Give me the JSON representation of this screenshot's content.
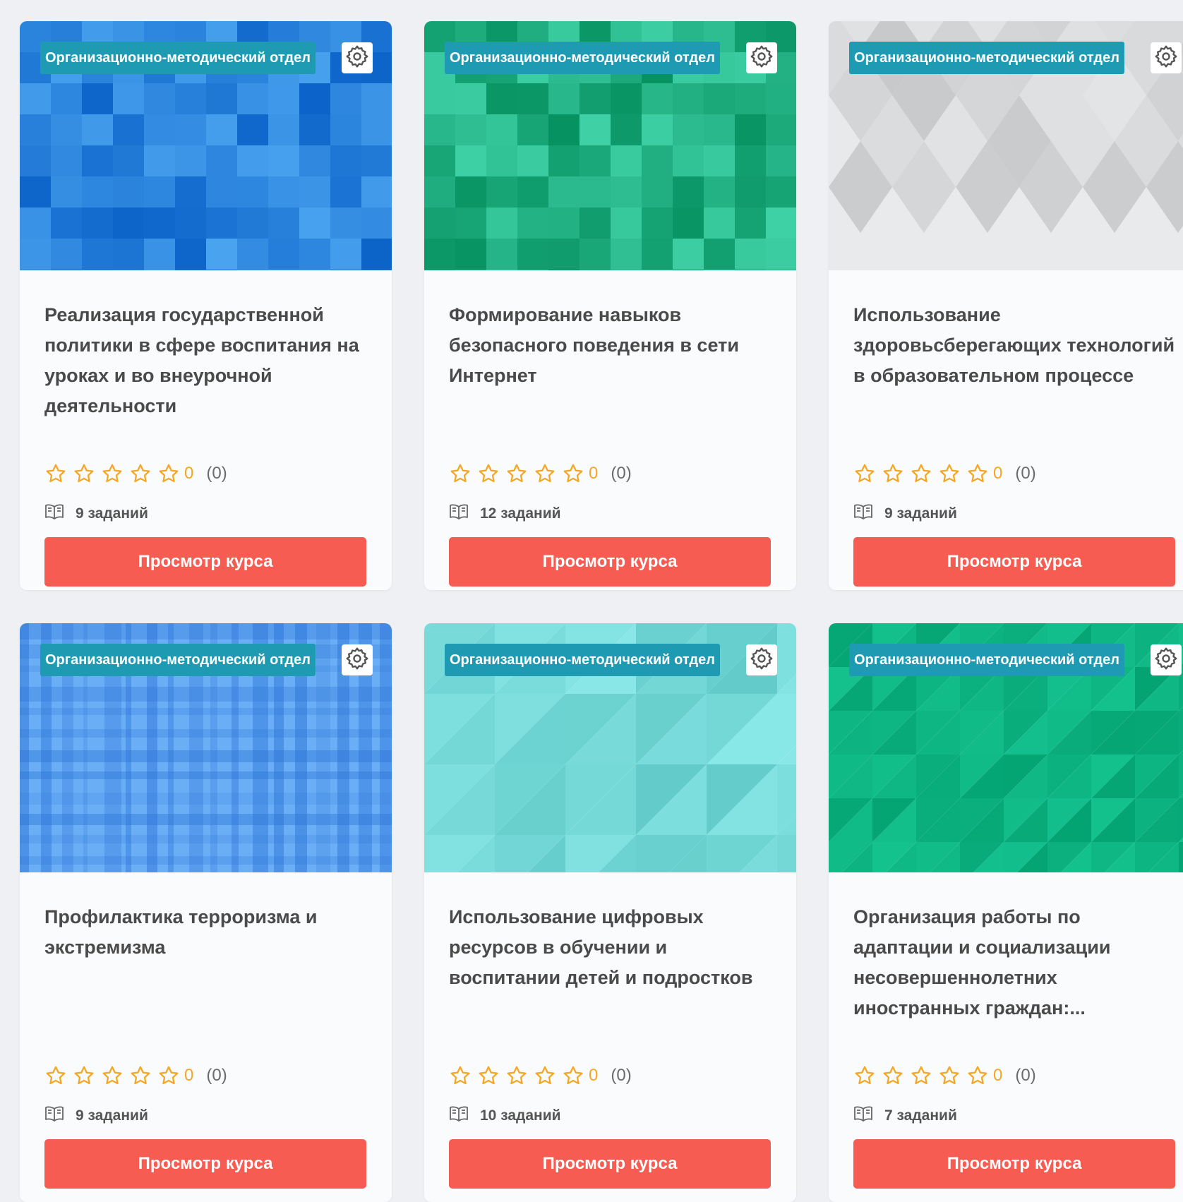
{
  "courses": [
    {
      "department": "Организационно-методический отдел",
      "title": "Реализация государственной политики в сфере воспитания на уроках и во внеурочной деятельности",
      "rating": "0",
      "reviews": "(0)",
      "tasks": "9 заданий",
      "button": "Просмотр курса",
      "cover_style": "pixel-blue"
    },
    {
      "department": "Организационно-методический отдел",
      "title": "Формирование навыков безопасного поведения в сети Интернет",
      "rating": "0",
      "reviews": "(0)",
      "tasks": "12 заданий",
      "button": "Просмотр курса",
      "cover_style": "pixel-green"
    },
    {
      "department": "Организационно-методический отдел",
      "title": "Использование здоровьсберегающих технологий в образовательном процессе",
      "rating": "0",
      "reviews": "(0)",
      "tasks": "9 заданий",
      "button": "Просмотр курса",
      "cover_style": "diamonds-gray"
    },
    {
      "department": "Организационно-методический отдел",
      "title": "Профилактика терроризма и экстремизма",
      "rating": "0",
      "reviews": "(0)",
      "tasks": "9 заданий",
      "button": "Просмотр курса",
      "cover_style": "plaid-blue"
    },
    {
      "department": "Организационно-методический отдел",
      "title": "Использование цифровых ресурсов в обучении и воспитании детей и подростков",
      "rating": "0",
      "reviews": "(0)",
      "tasks": "10 заданий",
      "button": "Просмотр курса",
      "cover_style": "triangles-cyan"
    },
    {
      "department": "Организационно-методический отдел",
      "title": "Организация работы по адаптации и социализации несовершеннолетних иностранных граждан:...",
      "rating": "0",
      "reviews": "(0)",
      "tasks": "7 заданий",
      "button": "Просмотр курса",
      "cover_style": "triangles-green"
    }
  ],
  "icons": {
    "settings": "gear-icon",
    "star": "star-outline-icon",
    "tasks": "book-open-icon"
  },
  "colors": {
    "badge": "#1e9bb3",
    "button": "#f65c51",
    "star": "#f5a623",
    "title": "#4a4a4a"
  }
}
